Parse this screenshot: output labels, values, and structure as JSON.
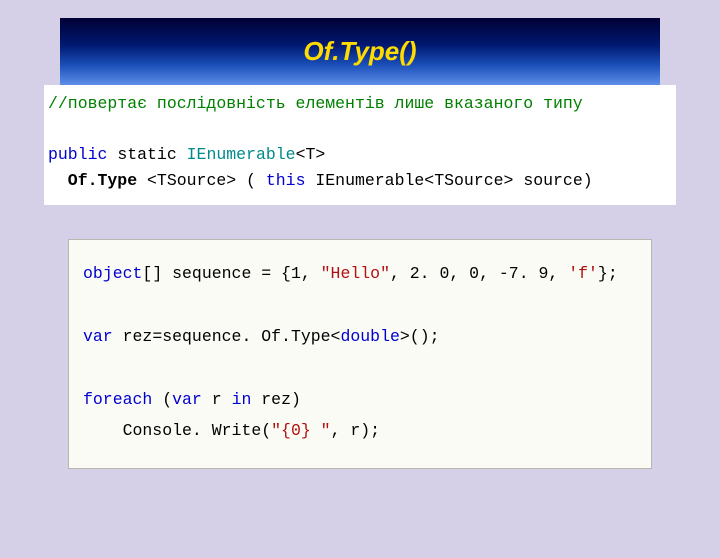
{
  "header": {
    "title": "Of.Type()"
  },
  "block1": {
    "line1_comment": "//повертає послідовність елементів лише вказаного типу",
    "line2_a": "public",
    "line2_b": " static ",
    "line2_c": "IEnumerable",
    "line2_d": "<T>",
    "line3_a": "  Of.Type ",
    "line3_b": "<TSource> ( ",
    "line3_c": "this",
    "line3_d": " IEnumerable",
    "line3_e": "<TSource> source)"
  },
  "block2": {
    "l1_a": "object",
    "l1_b": "[] sequence = {1, ",
    "l1_c": "\"Hello\"",
    "l1_d": ", 2. 0, 0, -7. 9, ",
    "l1_e": "'f'",
    "l1_f": "};",
    "l2_a": "var",
    "l2_b": " rez=sequence. Of.Type<",
    "l2_c": "double",
    "l2_d": ">();",
    "l3_a": "foreach",
    "l3_b": " (",
    "l3_c": "var",
    "l3_d": " r ",
    "l3_e": "in",
    "l3_f": " rez)",
    "l4_a": "    Console. Write(",
    "l4_b": "\"{0} \"",
    "l4_c": ", r);"
  }
}
